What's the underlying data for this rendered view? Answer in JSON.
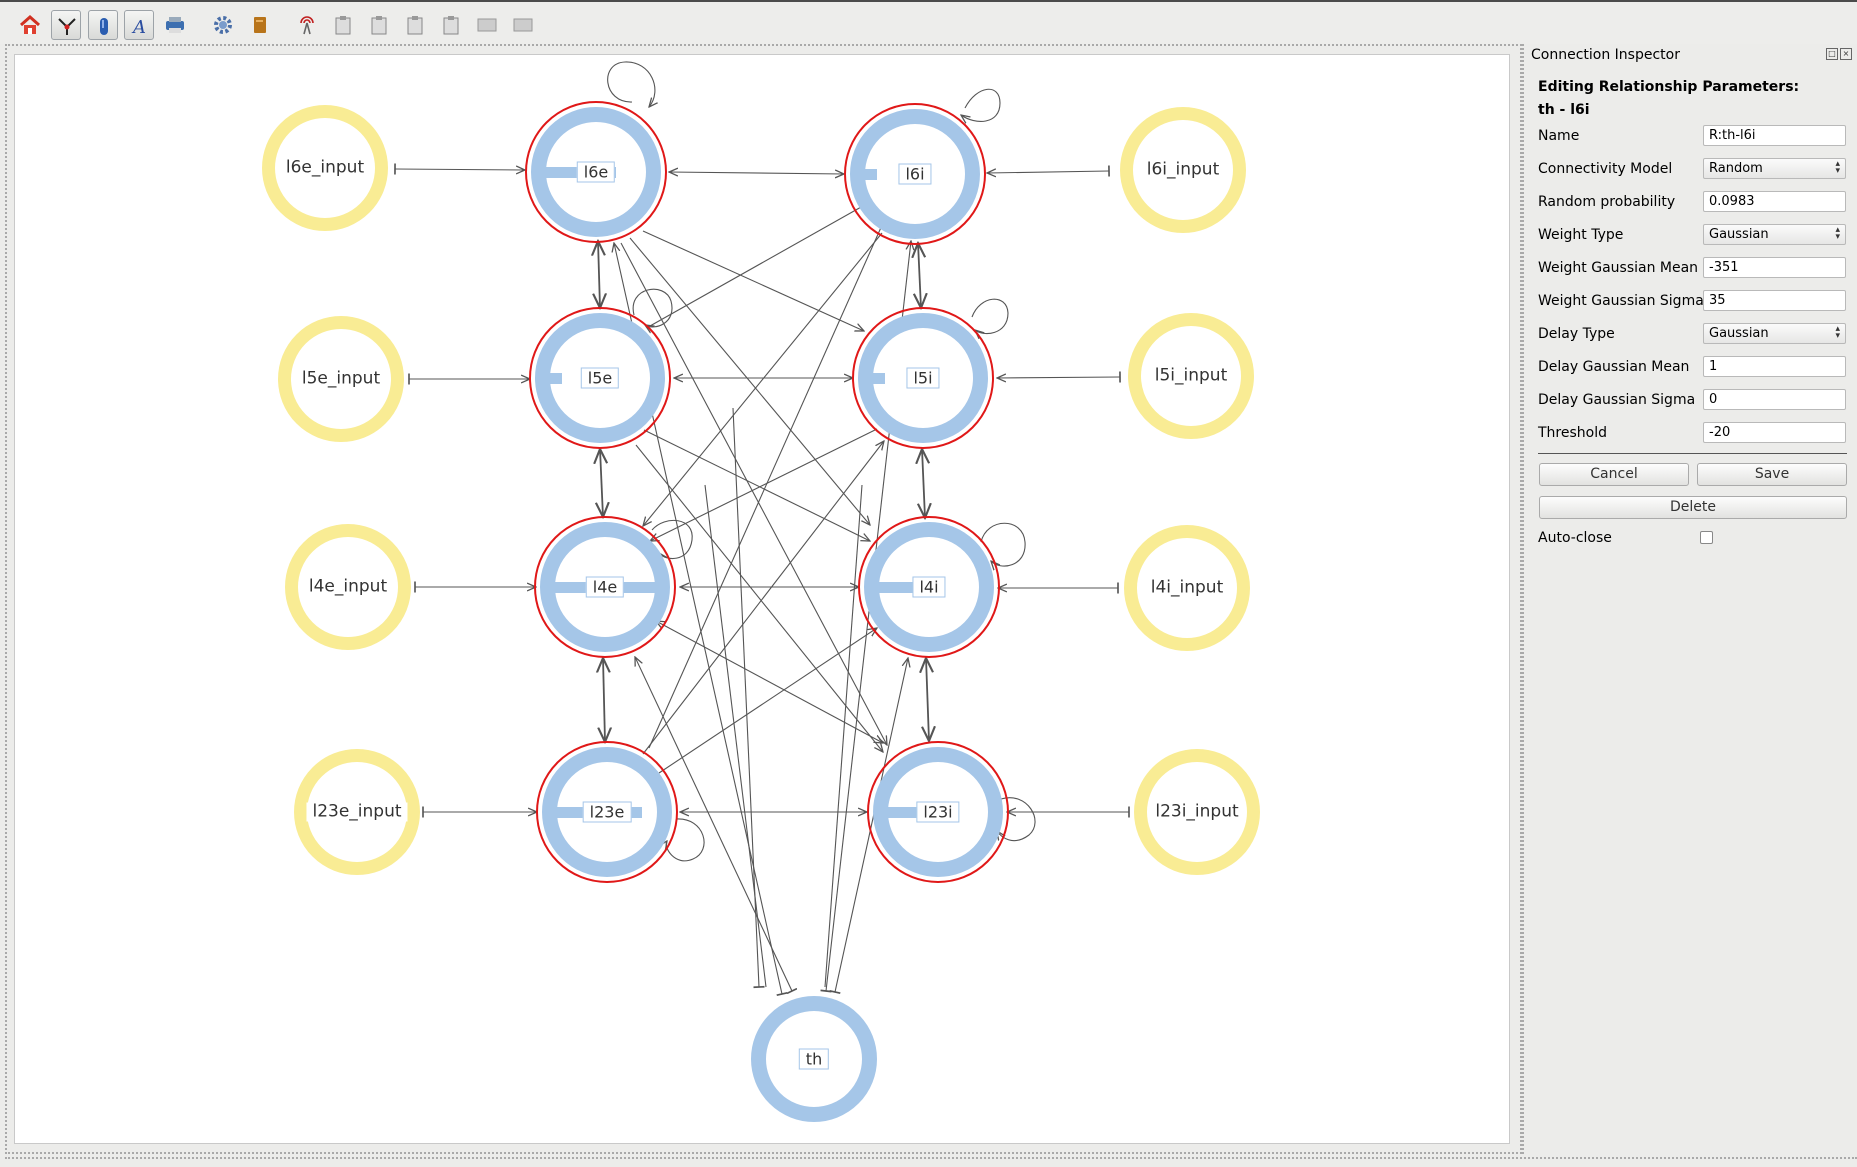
{
  "toolbar": {
    "tools": [
      {
        "icon": "home-icon"
      },
      {
        "icon": "connection-tool-icon",
        "active": true
      },
      {
        "icon": "population-tool-icon",
        "active": true
      },
      {
        "icon": "text-tool-icon",
        "active": true
      },
      {
        "icon": "printer-icon"
      },
      {
        "icon": "gear-icon"
      },
      {
        "icon": "book-icon"
      },
      {
        "icon": "antenna-icon"
      },
      {
        "icon": "clipboard-icon"
      },
      {
        "icon": "clipboard-icon"
      },
      {
        "icon": "clipboard-icon"
      },
      {
        "icon": "clipboard-icon"
      },
      {
        "icon": "screen-icon"
      },
      {
        "icon": "screen-icon"
      }
    ]
  },
  "network": {
    "populations": [
      {
        "id": "l6e",
        "label": "l6e",
        "selected": true
      },
      {
        "id": "l6i",
        "label": "l6i",
        "selected": true
      },
      {
        "id": "l5e",
        "label": "l5e",
        "selected": true
      },
      {
        "id": "l5i",
        "label": "l5i",
        "selected": true
      },
      {
        "id": "l4e",
        "label": "l4e",
        "selected": true
      },
      {
        "id": "l4i",
        "label": "l4i",
        "selected": true
      },
      {
        "id": "l23e",
        "label": "l23e",
        "selected": true
      },
      {
        "id": "l23i",
        "label": "l23i",
        "selected": true
      },
      {
        "id": "th",
        "label": "th",
        "selected": false
      }
    ],
    "inputs": [
      {
        "id": "l6e_input",
        "label": "l6e_input"
      },
      {
        "id": "l6i_input",
        "label": "l6i_input"
      },
      {
        "id": "l5e_input",
        "label": "l5e_input"
      },
      {
        "id": "l5i_input",
        "label": "l5i_input"
      },
      {
        "id": "l4e_input",
        "label": "l4e_input"
      },
      {
        "id": "l4i_input",
        "label": "l4i_input"
      },
      {
        "id": "l23e_input",
        "label": "l23e_input"
      },
      {
        "id": "l23i_input",
        "label": "l23i_input"
      }
    ],
    "colors": {
      "population": "#a5c6e8",
      "input": "#f9ec94",
      "selected_ring": "#e01818",
      "edge": "#555555"
    }
  },
  "inspector": {
    "title": "Connection Inspector",
    "heading": "Editing Relationship Parameters:",
    "subheading": "th - l6i",
    "fields": [
      {
        "label": "Name",
        "value": "R:th-l6i",
        "type": "text"
      },
      {
        "label": "Connectivity Model",
        "value": "Random",
        "type": "select"
      },
      {
        "label": "Random probability",
        "value": "0.0983",
        "type": "text"
      },
      {
        "label": "Weight Type",
        "value": "Gaussian",
        "type": "select"
      },
      {
        "label": "Weight Gaussian Mean",
        "value": "-351",
        "type": "text"
      },
      {
        "label": "Weight Gaussian Sigma",
        "value": "35",
        "type": "text"
      },
      {
        "label": "Delay Type",
        "value": "Gaussian",
        "type": "select"
      },
      {
        "label": "Delay Gaussian Mean",
        "value": "1",
        "type": "text"
      },
      {
        "label": "Delay Gaussian Sigma",
        "value": "0",
        "type": "text"
      },
      {
        "label": "Threshold",
        "value": "-20",
        "type": "text"
      }
    ],
    "cancel_label": "Cancel",
    "save_label": "Save",
    "delete_label": "Delete",
    "autoclose_label": "Auto-close",
    "autoclose_checked": false
  }
}
